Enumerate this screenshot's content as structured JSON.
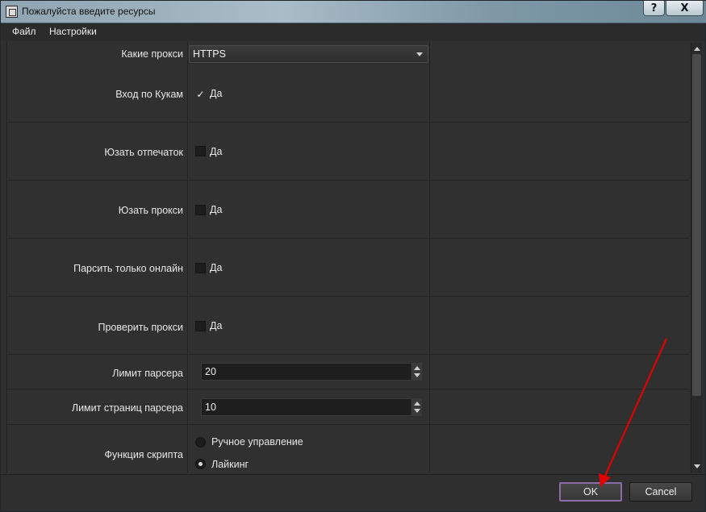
{
  "window": {
    "title": "Пожалуйста введите ресурсы",
    "help_label": "?",
    "close_label": "X"
  },
  "menu": {
    "file": "Файл",
    "settings": "Настройки"
  },
  "form": {
    "proxy_type": {
      "label": "Какие прокси",
      "value": "HTTPS"
    },
    "cookie_login": {
      "label": "Вход по Кукам",
      "option": "Да",
      "checked": true
    },
    "use_fingerprint": {
      "label": "Юзать отпечаток",
      "option": "Да",
      "checked": false
    },
    "use_proxy": {
      "label": "Юзать прокси",
      "option": "Да",
      "checked": false
    },
    "parse_online": {
      "label": "Парсить только онлайн",
      "option": "Да",
      "checked": false
    },
    "check_proxy": {
      "label": "Проверить прокси",
      "option": "Да",
      "checked": false
    },
    "parser_limit": {
      "label": "Лимит парсера",
      "value": "20"
    },
    "parser_page_limit": {
      "label": "Лимит страниц парсера",
      "value": "10"
    },
    "script_function": {
      "label": "Функция скрипта",
      "options": [
        "Ручное управление",
        "Лайкинг"
      ],
      "selected": "Лайкинг"
    }
  },
  "footer": {
    "ok_label": "OK",
    "cancel_label": "Cancel"
  },
  "colors": {
    "background": "#2f2f2f",
    "annotation_arrow": "#e00000",
    "ok_border": "#8b6aa8"
  }
}
